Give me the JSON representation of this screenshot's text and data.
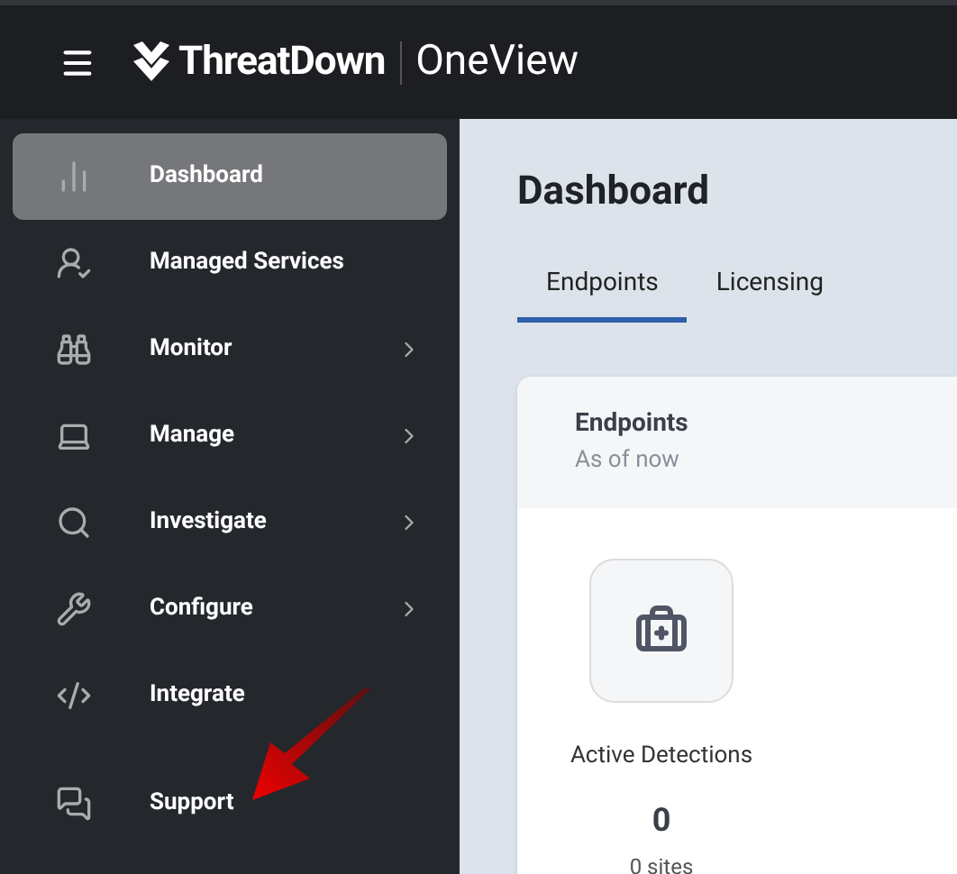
{
  "header": {
    "brand": "ThreatDown",
    "product": "OneView"
  },
  "sidebar": {
    "items": [
      {
        "label": "Dashboard",
        "selected": true,
        "has_submenu": false
      },
      {
        "label": "Managed Services",
        "selected": false,
        "has_submenu": false
      },
      {
        "label": "Monitor",
        "selected": false,
        "has_submenu": true
      },
      {
        "label": "Manage",
        "selected": false,
        "has_submenu": true
      },
      {
        "label": "Investigate",
        "selected": false,
        "has_submenu": true
      },
      {
        "label": "Configure",
        "selected": false,
        "has_submenu": true
      },
      {
        "label": "Integrate",
        "selected": false,
        "has_submenu": false
      },
      {
        "label": "Support",
        "selected": false,
        "has_submenu": false
      }
    ]
  },
  "page": {
    "title": "Dashboard",
    "tabs": [
      {
        "label": "Endpoints",
        "selected": true
      },
      {
        "label": "Licensing",
        "selected": false
      }
    ],
    "card": {
      "title": "Endpoints",
      "subtitle": "As of now",
      "metric": {
        "label": "Active Detections",
        "value": "0",
        "detail": "0 sites"
      }
    }
  }
}
